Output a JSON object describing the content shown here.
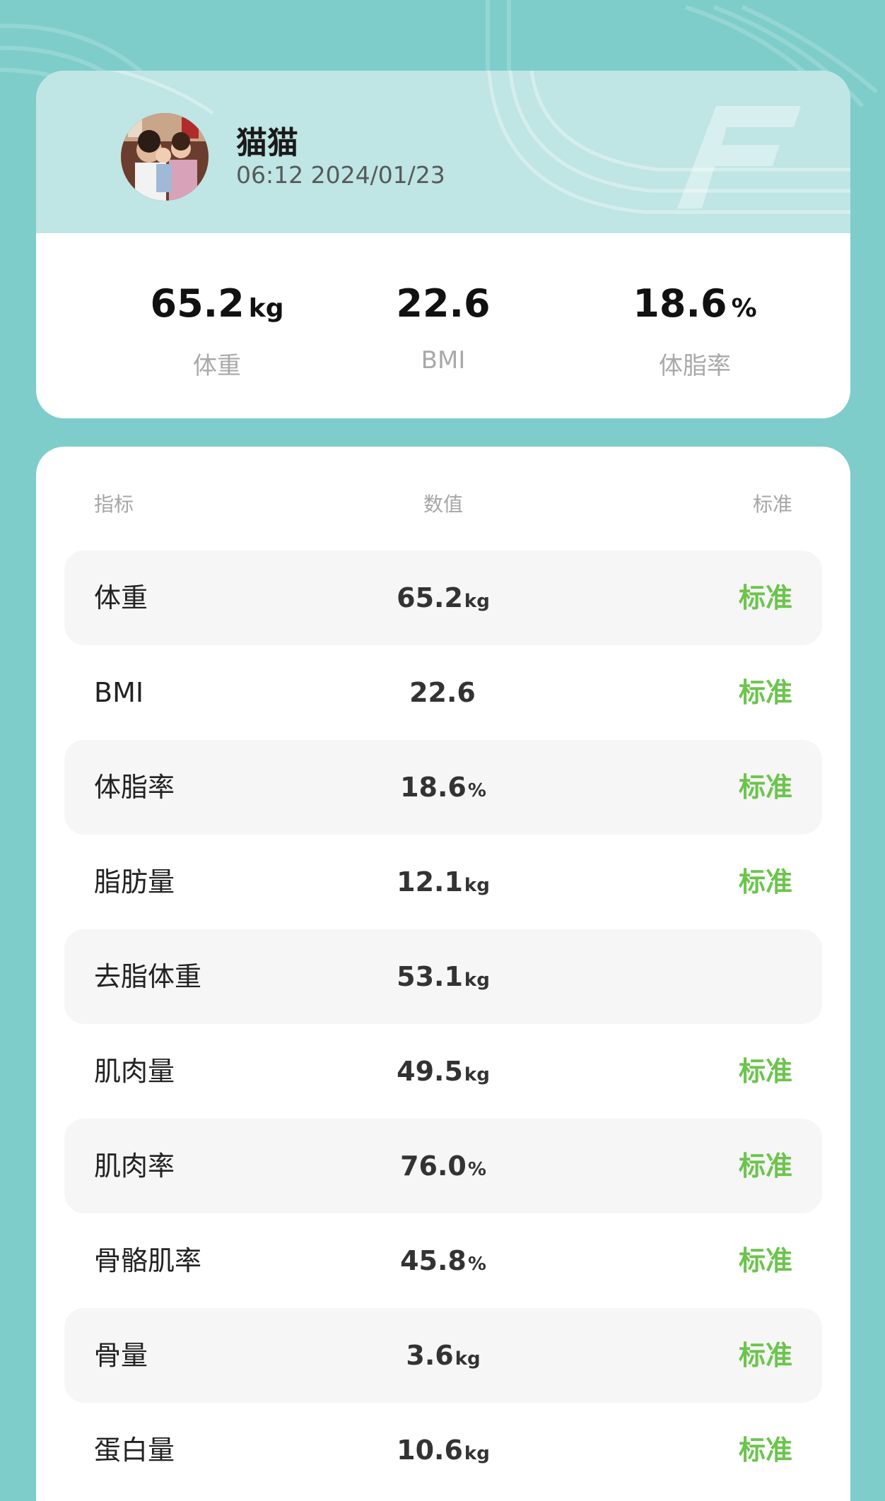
{
  "profile": {
    "name": "猫猫",
    "timestamp": "06:12 2024/01/23"
  },
  "summary": [
    {
      "value": "65.2",
      "unit": "kg",
      "label": "体重"
    },
    {
      "value": "22.6",
      "unit": "",
      "label": "BMI"
    },
    {
      "value": "18.6",
      "unit": "%",
      "label": "体脂率"
    }
  ],
  "table": {
    "headers": {
      "name": "指标",
      "value": "数值",
      "standard": "标准"
    },
    "rows": [
      {
        "name": "体重",
        "value": "65.2",
        "unit": "kg",
        "standard": "标准"
      },
      {
        "name": "BMI",
        "value": "22.6",
        "unit": "",
        "standard": "标准"
      },
      {
        "name": "体脂率",
        "value": "18.6",
        "unit": "%",
        "standard": "标准"
      },
      {
        "name": "脂肪量",
        "value": "12.1",
        "unit": "kg",
        "standard": "标准"
      },
      {
        "name": "去脂体重",
        "value": "53.1",
        "unit": "kg",
        "standard": ""
      },
      {
        "name": "肌肉量",
        "value": "49.5",
        "unit": "kg",
        "standard": "标准"
      },
      {
        "name": "肌肉率",
        "value": "76.0",
        "unit": "%",
        "standard": "标准"
      },
      {
        "name": "骨骼肌率",
        "value": "45.8",
        "unit": "%",
        "standard": "标准"
      },
      {
        "name": "骨量",
        "value": "3.6",
        "unit": "kg",
        "standard": "标准"
      },
      {
        "name": "蛋白量",
        "value": "10.6",
        "unit": "kg",
        "standard": "标准"
      }
    ]
  },
  "colors": {
    "background": "#7ecdcb",
    "header": "#bfe5e4",
    "standard_green": "#6cc44d"
  }
}
